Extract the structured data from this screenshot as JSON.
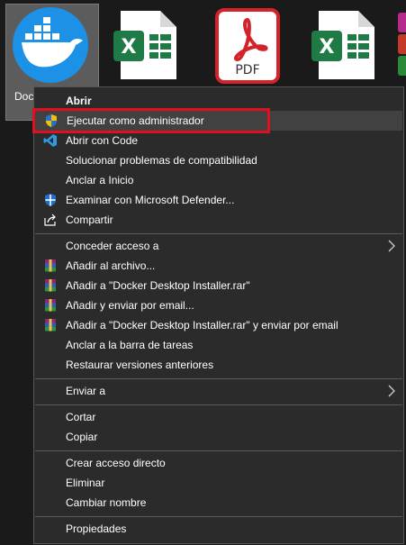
{
  "desktop": {
    "docker_label": "Doc",
    "pdf_label": "PDF",
    "excel_letter": "X"
  },
  "menu": {
    "open": "Abrir",
    "run_as_admin": "Ejecutar como administrador",
    "open_with_code": "Abrir con Code",
    "troubleshoot": "Solucionar problemas de compatibilidad",
    "pin_start": "Anclar a Inicio",
    "scan_defender": "Examinar con Microsoft Defender...",
    "share": "Compartir",
    "give_access": "Conceder acceso a",
    "add_archive": "Añadir al archivo...",
    "add_rar": "Añadir a \"Docker Desktop Installer.rar\"",
    "add_email": "Añadir y enviar por email...",
    "add_rar_email": "Añadir a \"Docker Desktop Installer.rar\" y enviar por email",
    "pin_taskbar": "Anclar a la barra de tareas",
    "restore_versions": "Restaurar versiones anteriores",
    "send_to": "Enviar a",
    "cut": "Cortar",
    "copy": "Copiar",
    "create_shortcut": "Crear acceso directo",
    "delete": "Eliminar",
    "rename": "Cambiar nombre",
    "properties": "Propiedades"
  },
  "colors": {
    "highlight_border": "#e01020",
    "docker_blue": "#1d91e6",
    "excel_green": "#1f7a45",
    "pdf_red": "#d3222a"
  }
}
